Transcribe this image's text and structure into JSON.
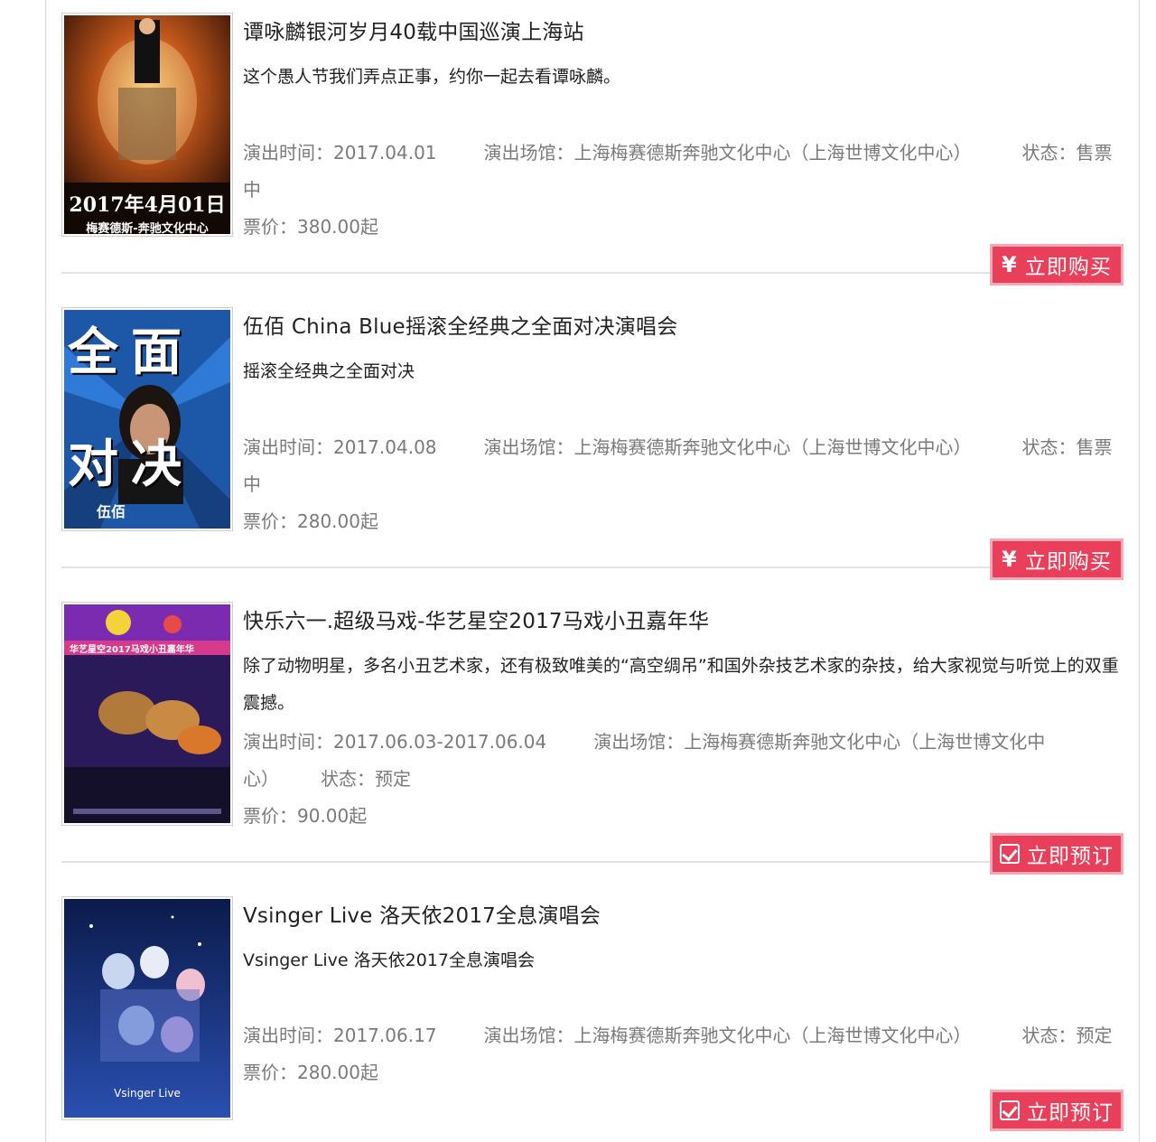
{
  "labels": {
    "time_prefix": "演出时间：",
    "venue_prefix": "演出场馆：",
    "status_prefix": "状态：",
    "price_prefix": "票价：",
    "price_suffix": "起",
    "buy_icon": "¥",
    "buy_label": "立即购买",
    "book_label": "立即预订"
  },
  "events": [
    {
      "title": "谭咏麟银河岁月40载中国巡演上海站",
      "desc": "这个愚人节我们弄点正事，约你一起去看谭咏麟。",
      "time": "2017.04.01",
      "venue": "上海梅赛德斯奔驰文化中心（上海世博文化中心）",
      "status": "售票中",
      "price": "380.00",
      "poster_text": "2017年4月01日",
      "poster_sub": "梅赛德斯-奔驰文化中心",
      "action": "buy"
    },
    {
      "title": "伍佰 China Blue摇滚全经典之全面对决演唱会",
      "desc": "摇滚全经典之全面对决",
      "time": "2017.04.08",
      "venue": "上海梅赛德斯奔驰文化中心（上海世博文化中心）",
      "status": "售票中",
      "price": "280.00",
      "poster_text": "全 面 对 决",
      "poster_sub": "伍佰",
      "action": "buy"
    },
    {
      "title": "快乐六一.超级马戏-华艺星空2017马戏小丑嘉年华",
      "desc": "除了动物明星，多名小丑艺术家，还有极致唯美的“高空绸吊”和国外杂技艺术家的杂技，给大家视觉与听觉上的双重震撼。",
      "time": "2017.06.03-2017.06.04",
      "venue": "上海梅赛德斯奔驰文化中心（上海世博文化中心）",
      "status": "预定",
      "price": "90.00",
      "poster_text": "华艺星空2017马戏小丑嘉年华",
      "poster_sub": "",
      "action": "book"
    },
    {
      "title": "Vsinger Live 洛天依2017全息演唱会",
      "desc": "Vsinger Live 洛天依2017全息演唱会",
      "time": "2017.06.17",
      "venue": "上海梅赛德斯奔驰文化中心（上海世博文化中心）",
      "status": "预定",
      "price": "280.00",
      "poster_text": "",
      "poster_sub": "Vsinger Live",
      "action": "book"
    }
  ],
  "colors": {
    "button_bg": "#ea3f5a",
    "button_border": "#f7a8b6",
    "meta_text": "#7a7a7a",
    "title_text": "#222222"
  }
}
